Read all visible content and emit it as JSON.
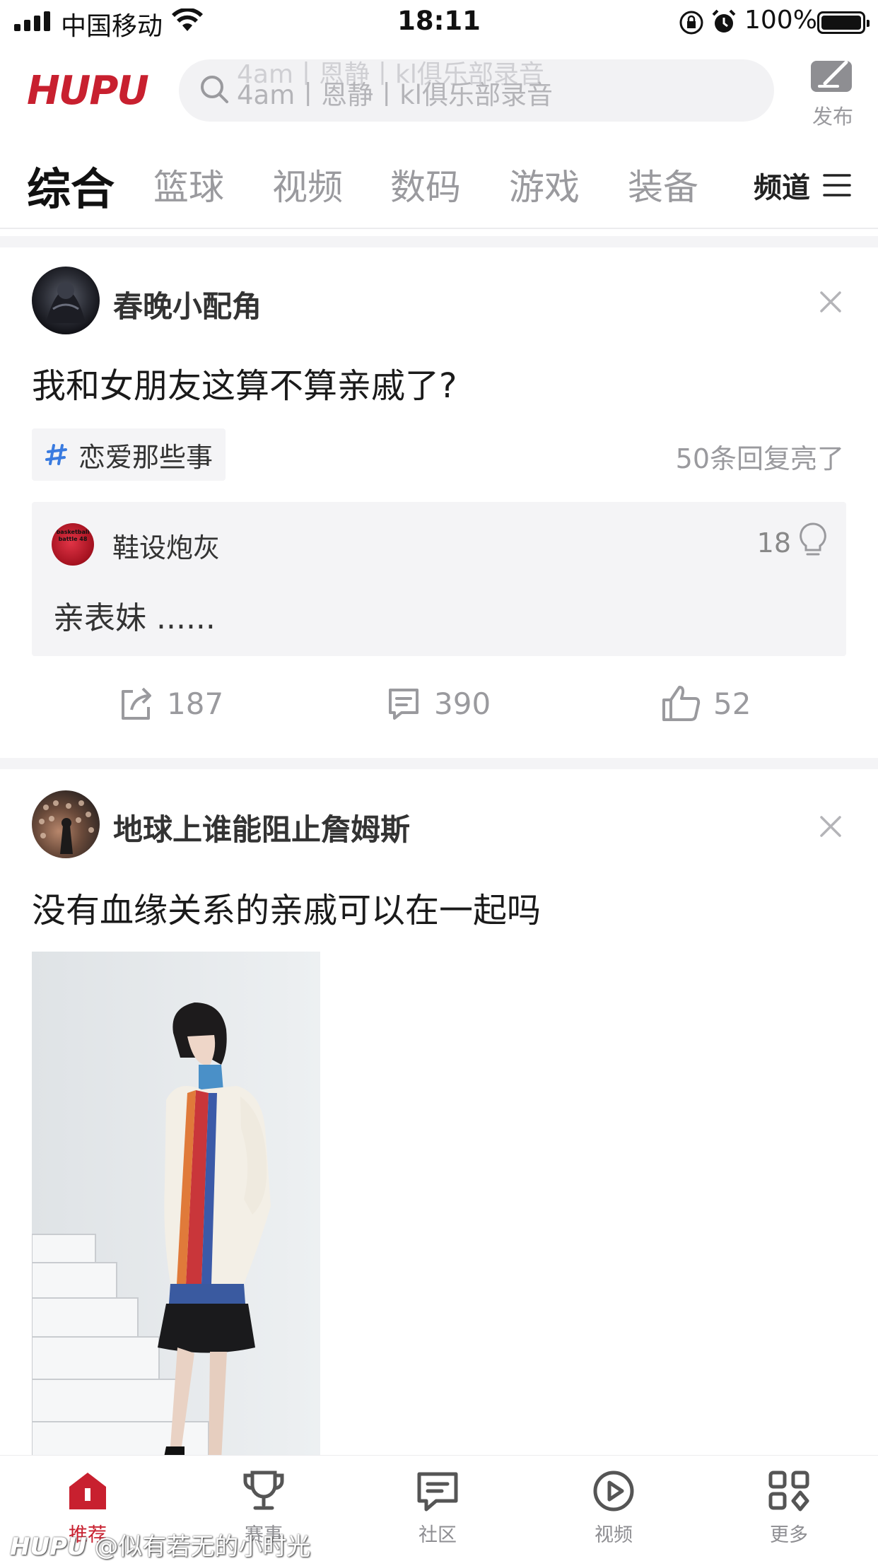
{
  "status_bar": {
    "carrier": "中国移动",
    "time": "18:11",
    "battery": "100%"
  },
  "header": {
    "logo": "HUPU",
    "search_placeholder": "4am丨恩静丨kl俱乐部录音",
    "publish_label": "发布"
  },
  "tabs": [
    {
      "label": "综合",
      "active": true
    },
    {
      "label": "篮球"
    },
    {
      "label": "视频"
    },
    {
      "label": "数码"
    },
    {
      "label": "游戏"
    },
    {
      "label": "装备"
    }
  ],
  "channel_label": "频道",
  "posts": [
    {
      "author": "春晚小配角",
      "title": "我和女朋友这算不算亲戚了?",
      "topic": "恋爱那些事",
      "replies_lit": "50条回复亮了",
      "hot_reply": {
        "author": "鞋设炮灰",
        "avatar_text": "basketball battle 48",
        "likes": "18",
        "text": "亲表妹 ......"
      },
      "shares": "187",
      "comments": "390",
      "likes": "52"
    },
    {
      "author": "地球上谁能阻止詹姆斯",
      "title": "没有血缘关系的亲戚可以在一起吗"
    }
  ],
  "bottom_nav": [
    {
      "label": "推荐",
      "icon": "home-icon",
      "active": true
    },
    {
      "label": "赛事",
      "icon": "trophy-icon"
    },
    {
      "label": "社区",
      "icon": "community-icon"
    },
    {
      "label": "视频",
      "icon": "video-play-icon"
    },
    {
      "label": "更多",
      "icon": "more-grid-icon"
    }
  ],
  "watermark": {
    "logo": "HUPU",
    "text": "@似有若无的小时光"
  },
  "colors": {
    "brand_red": "#c8202f",
    "muted_gray": "#9a9a9e",
    "panel_gray": "#f4f4f6"
  }
}
